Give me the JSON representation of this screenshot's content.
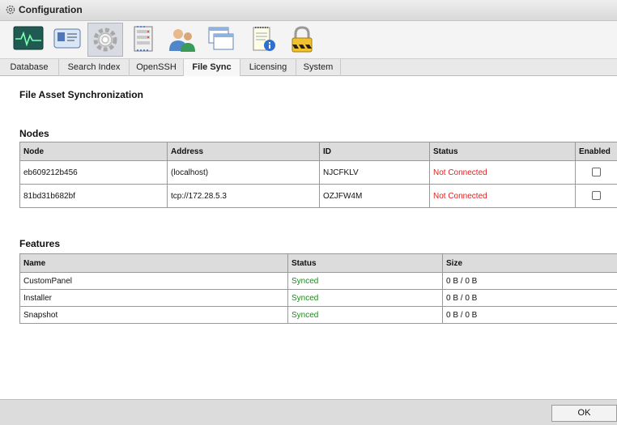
{
  "window": {
    "title": "Configuration"
  },
  "toolbar": {
    "icons": [
      {
        "name": "monitor-icon"
      },
      {
        "name": "id-card-icon"
      },
      {
        "name": "gear-icon",
        "selected": true
      },
      {
        "name": "server-rack-icon"
      },
      {
        "name": "users-icon"
      },
      {
        "name": "windows-icon"
      },
      {
        "name": "notepad-info-icon"
      },
      {
        "name": "padlock-icon"
      }
    ]
  },
  "tabs": [
    {
      "label": "Database"
    },
    {
      "label": "Search Index"
    },
    {
      "label": "OpenSSH"
    },
    {
      "label": "File Sync",
      "active": true
    },
    {
      "label": "Licensing"
    },
    {
      "label": "System"
    }
  ],
  "page": {
    "title": "File Asset Synchronization"
  },
  "nodes": {
    "heading": "Nodes",
    "columns": [
      "Node",
      "Address",
      "ID",
      "Status",
      "Enabled"
    ],
    "rows": [
      {
        "node": "eb609212b456",
        "address": "(localhost)",
        "id": "NJCFKLV",
        "status": "Not Connected",
        "enabled": false
      },
      {
        "node": "81bd31b682bf",
        "address": "tcp://172.28.5.3",
        "id": "OZJFW4M",
        "status": "Not Connected",
        "enabled": false
      }
    ]
  },
  "features": {
    "heading": "Features",
    "columns": [
      "Name",
      "Status",
      "Size"
    ],
    "rows": [
      {
        "name": "CustomPanel",
        "status": "Synced",
        "size": "0 B / 0 B"
      },
      {
        "name": "Installer",
        "status": "Synced",
        "size": "0 B / 0 B"
      },
      {
        "name": "Snapshot",
        "status": "Synced",
        "size": "0 B / 0 B"
      }
    ]
  },
  "footer": {
    "ok_label": "OK"
  },
  "colors": {
    "error": "#e02020",
    "success": "#1a8a1a",
    "header_bg": "#dcdcdc"
  }
}
